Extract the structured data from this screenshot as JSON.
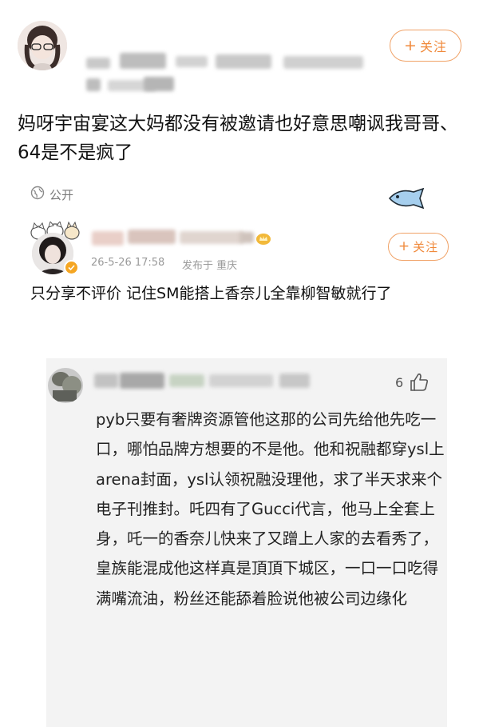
{
  "post": {
    "follow_label": "关注",
    "follow_plus": "+",
    "text": "妈呀宇宙宴这大妈都没有被邀请也好意思嘲讽我哥哥、64是不是疯了",
    "visibility_label": "公开"
  },
  "reply": {
    "follow_label": "关注",
    "follow_plus": "+",
    "timestamp": "26-5-26 17:58",
    "location_label": "发布于 重庆",
    "text": "只分享不评价 记住SM能搭上香奈儿全靠柳智敏就行了"
  },
  "sub_comment": {
    "like_count": "6",
    "text": "pyb只要有奢牌资源管他这那的公司先给他先吃一口，哪怕品牌方想要的不是他。他和祝融都穿ysl上arena封面，ysl认领祝融没理他，求了半天求来个电子刊推封。吒四有了Gucci代言，他马上全套上身，吒一的香奈儿快来了又蹭上人家的去看秀了，皇族能混成他这样真是頂頂下城区，一口一口吃得满嘴流油，粉丝还能舔着脸说他被公司边缘化"
  },
  "colors": {
    "accent_orange": "#f08a3c",
    "follow_border": "#f0a267",
    "sub_background": "#f3f3f3",
    "meta_gray": "#9a9a9a",
    "fish_blue": "#a6cfee"
  },
  "icons": [
    "avatar",
    "globe-icon",
    "fish-sticker-icon",
    "verified-badge-icon",
    "thumbs-up-icon",
    "crown-badge-icon"
  ]
}
